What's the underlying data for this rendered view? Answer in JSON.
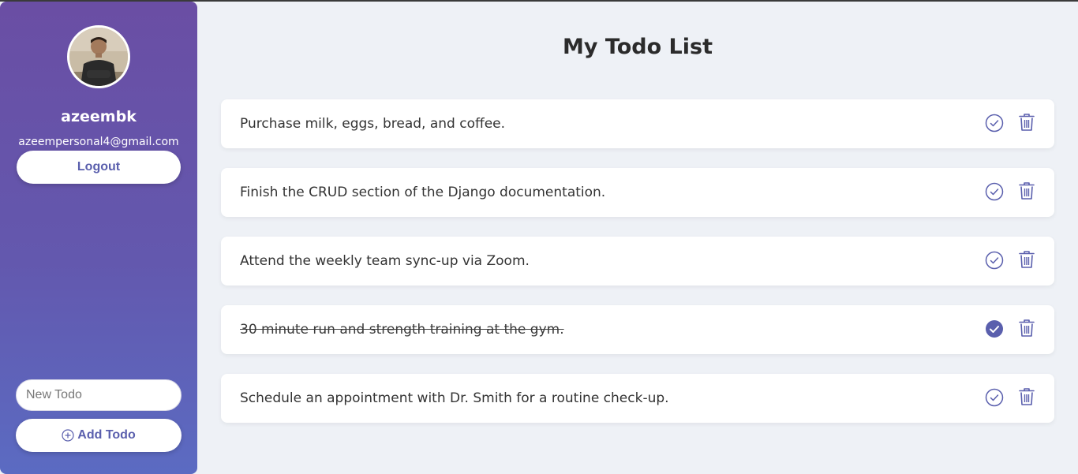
{
  "user": {
    "username": "azeembk",
    "email": "azeempersonal4@gmail.com",
    "logout_label": "Logout"
  },
  "add_form": {
    "placeholder": "New Todo",
    "button_label": "Add Todo"
  },
  "main": {
    "title": "My Todo List"
  },
  "todos": [
    {
      "text": "Purchase milk, eggs, bread, and coffee.",
      "completed": false
    },
    {
      "text": "Finish the CRUD section of the Django documentation.",
      "completed": false
    },
    {
      "text": "Attend the weekly team sync-up via Zoom.",
      "completed": false
    },
    {
      "text": "30  minute run and strength training at the gym.",
      "completed": true
    },
    {
      "text": "Schedule an appointment with Dr. Smith for a routine check-up.",
      "completed": false
    }
  ],
  "colors": {
    "accent": "#5a5fad",
    "sidebar_top": "#6a4ea4",
    "sidebar_bottom": "#5b6bc2",
    "background": "#eef1f6"
  },
  "icons": {
    "complete": "check-circle-icon",
    "delete": "trash-icon",
    "add": "plus-circle-icon"
  }
}
